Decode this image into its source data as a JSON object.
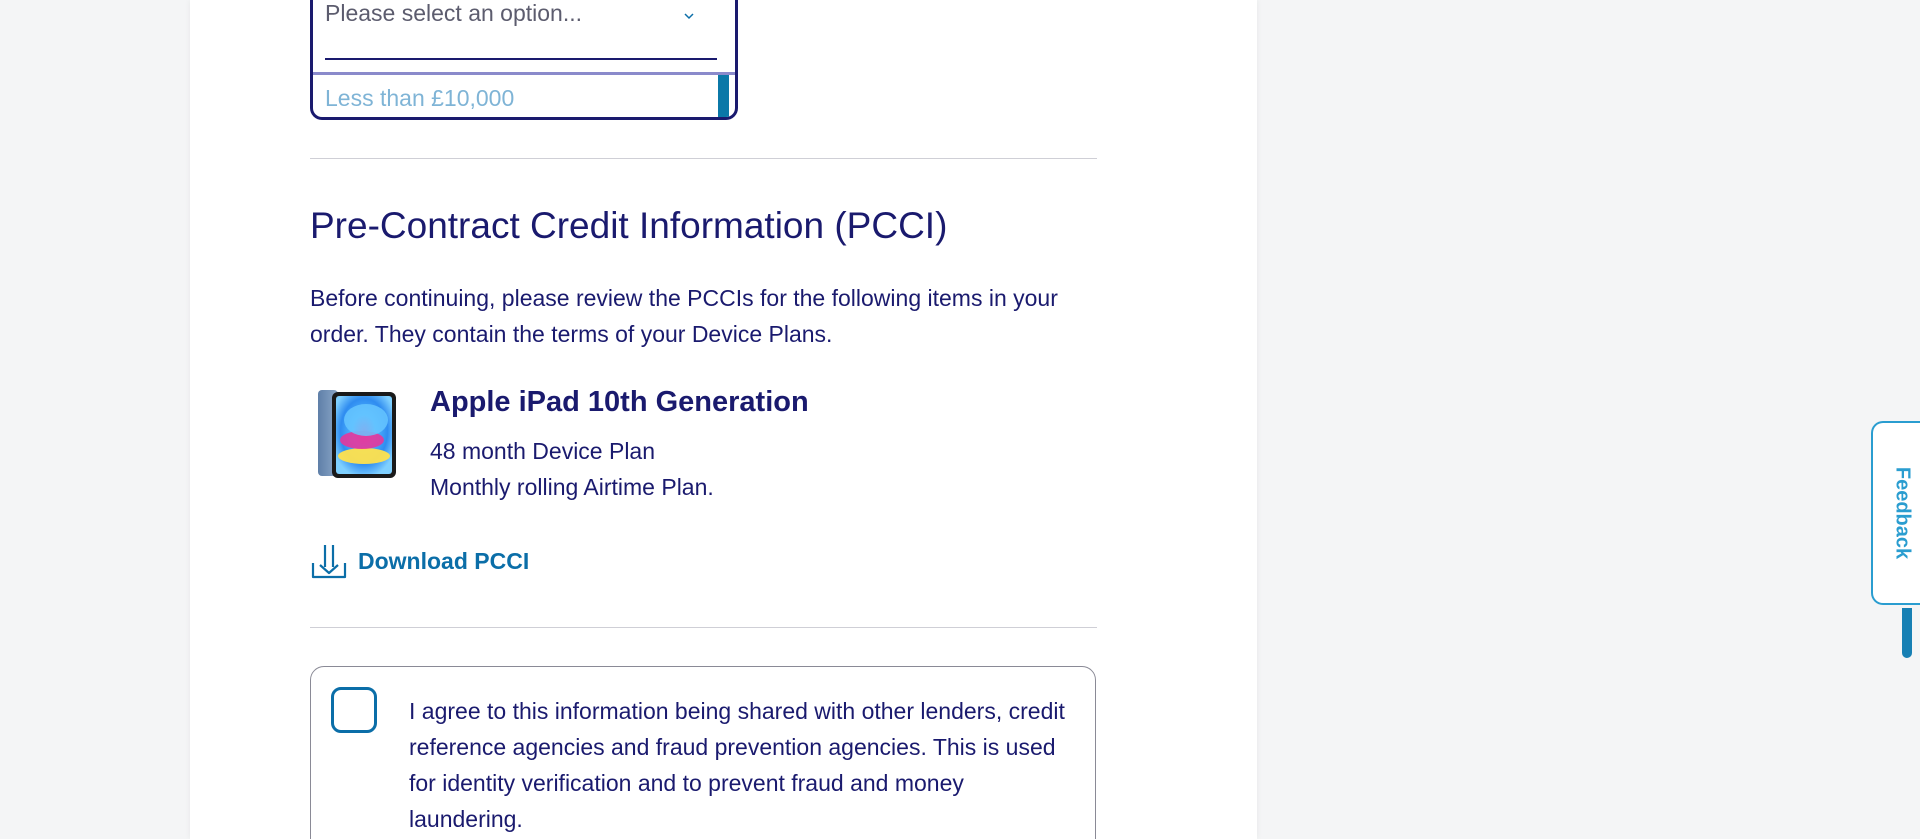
{
  "dropdown": {
    "placeholder": "Please select an option...",
    "options": [
      "Less than £10,000"
    ]
  },
  "pcci": {
    "title": "Pre-Contract Credit Information (PCCI)",
    "intro": "Before continuing, please review the PCCIs for the following items in your order. They contain the terms of your Device Plans.",
    "device": {
      "name": "Apple iPad 10th Generation",
      "plan_line_1": "48 month Device Plan",
      "plan_line_2": "Monthly rolling Airtime Plan."
    },
    "download_label": "Download PCCI"
  },
  "consent": {
    "checked": false,
    "text": "I agree to this information being shared with other lenders, credit reference agencies and fraud prevention agencies. This is used for identity verification and to prevent fraud and money laundering."
  },
  "feedback": {
    "label": "Feedback"
  },
  "colors": {
    "navy": "#1a1a6e",
    "accent_blue": "#0b6ea8",
    "feedback_blue": "#2a9dd0",
    "background": "#f4f5f6"
  }
}
